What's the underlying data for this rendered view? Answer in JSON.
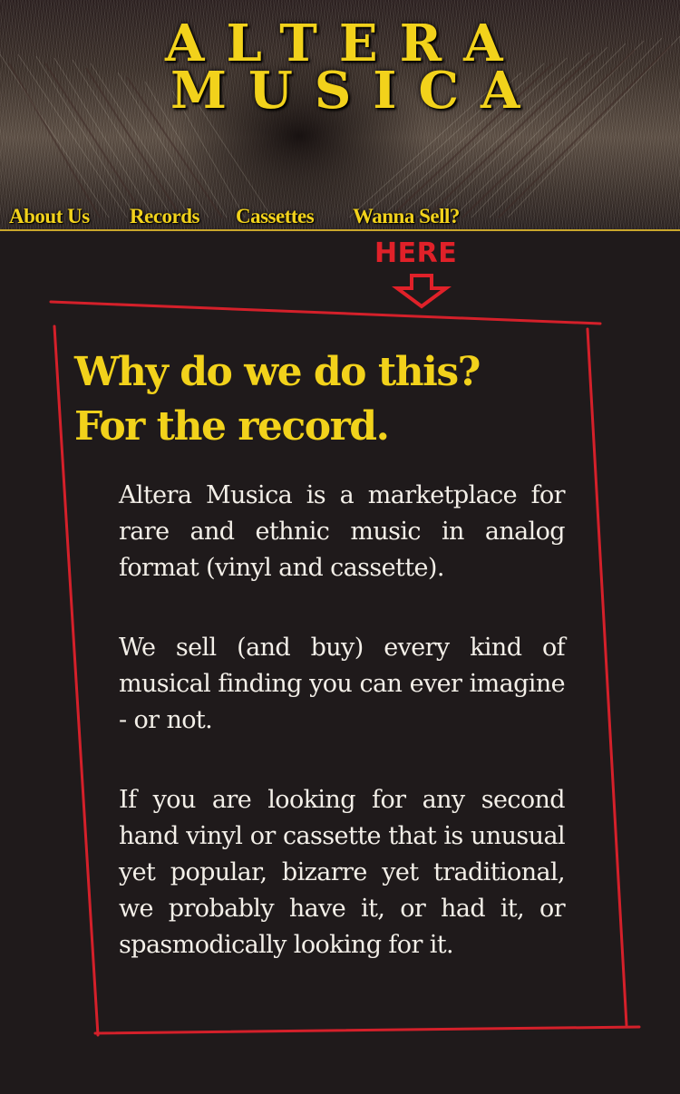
{
  "brand": {
    "line1": "ALTERA",
    "line2": "MUSICA"
  },
  "nav": {
    "items": [
      {
        "label": "About Us"
      },
      {
        "label": "Records"
      },
      {
        "label": "Cassettes"
      },
      {
        "label": "Wanna Sell?"
      }
    ]
  },
  "marker": {
    "label": "HERE",
    "icon": "down-arrow-icon"
  },
  "content": {
    "heading_line1": "Why do we do this?",
    "heading_line2": "For the record.",
    "paragraphs": [
      "Altera Musica is a marketplace for rare and ethnic music in analog format (vinyl and cassette).",
      "We sell (and buy) every kind of musical finding you can ever imagine - or not.",
      "If you are looking for any second hand vinyl or cassette that is unusual yet popular, bizarre yet traditional, we probably have it, or had it, or spasmodically looking for it."
    ]
  },
  "colors": {
    "background": "#1f1a1b",
    "accent_yellow": "#f2d21b",
    "accent_red": "#e02129",
    "text": "#f3efe8"
  }
}
